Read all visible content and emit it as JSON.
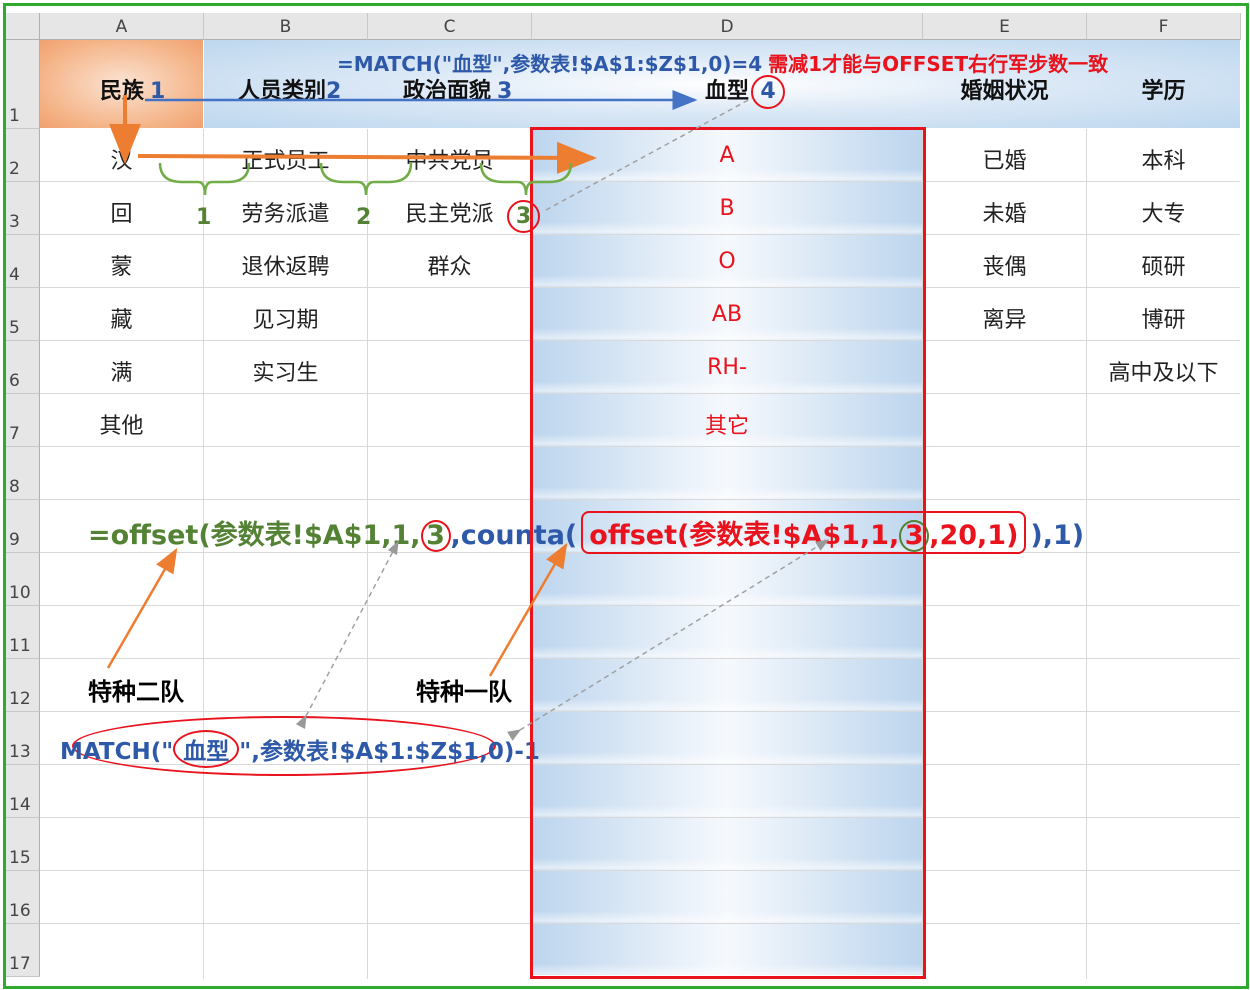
{
  "columns": [
    "A",
    "B",
    "C",
    "D",
    "E",
    "F"
  ],
  "rows": [
    "1",
    "2",
    "3",
    "4",
    "5",
    "6",
    "7",
    "8",
    "9",
    "10",
    "11",
    "12",
    "13",
    "14",
    "15",
    "16",
    "17"
  ],
  "header_row": {
    "A": "民族",
    "A_num": "1",
    "B": "人员类别",
    "B_num": "2",
    "C": "政治面貌",
    "C_num": "3",
    "D": "血型",
    "D_num": "4",
    "E": "婚姻状况",
    "F": "学历"
  },
  "top_note": {
    "formula": "=MATCH(\"血型\",参数表!$A$1:$Z$1,0)=4",
    "remark": "需减1才能与OFFSET右行军步数一致"
  },
  "col_A": [
    "汉",
    "回",
    "蒙",
    "藏",
    "满",
    "其他"
  ],
  "col_B": [
    "正式员工",
    "劳务派遣",
    "退休返聘",
    "见习期",
    "实习生"
  ],
  "col_C": [
    "中共党员",
    "民主党派",
    "群众"
  ],
  "col_D": [
    "A",
    "B",
    "O",
    "AB",
    "RH-",
    "其它"
  ],
  "col_E": [
    "已婚",
    "未婚",
    "丧偶",
    "离异"
  ],
  "col_F": [
    "本科",
    "大专",
    "硕研",
    "博研",
    "高中及以下"
  ],
  "brace_labels": [
    "1",
    "2",
    "3"
  ],
  "circled_three": "3",
  "formula_line": {
    "part1": "=offset(参数表!$A$1,1,",
    "circled1": "3",
    "part2": ",counta(",
    "part3": "offset(参数表!$A$1,1,",
    "circled2": "3",
    "part4": ",20,1)",
    "part5": "),1)"
  },
  "label_team2": "特种二队",
  "label_team1": "特种一队",
  "match_formula": {
    "pre": "MATCH(\"",
    "circled": "血型",
    "post": "\",参数表!$A$1:$Z$1,0)-1"
  },
  "colors": {
    "frame": "#2eaa2e",
    "header_orange": "#f4b183",
    "header_blue": "#bdd7ee",
    "red": "#e8131d",
    "blue": "#2e59a8",
    "green": "#548235",
    "arrow_orange": "#ed7d31"
  }
}
